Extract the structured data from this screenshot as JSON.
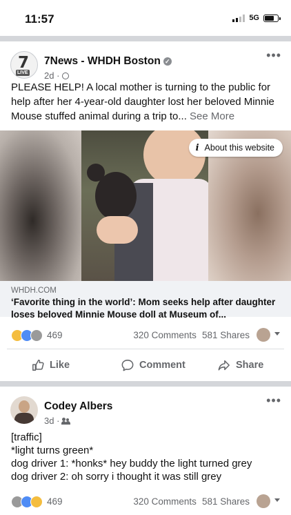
{
  "status_bar": {
    "time": "11:57",
    "network": "5G",
    "battery_level": 0.65
  },
  "post1": {
    "page_name": "7News - WHDH Boston",
    "avatar_text": "7",
    "avatar_badge": "LIVE",
    "meta": "2d ·",
    "body": "PLEASE HELP!  A local mother is turning to the public for help after her 4-year-old daughter lost her beloved Minnie Mouse stuffed animal during a trip to...",
    "see_more": "See More",
    "about_site": "About this website",
    "link_domain": "WHDH.COM",
    "link_title": "‘Favorite thing in the world’: Mom seeks help after daughter loses beloved Minnie Mouse doll at Museum of...",
    "reaction_count": "469",
    "comments": "320 Comments",
    "shares": "581 Shares",
    "actions": {
      "like": "Like",
      "comment": "Comment",
      "share": "Share"
    }
  },
  "post2": {
    "author": "Codey Albers",
    "meta": "3d ·",
    "lines": [
      "[traffic]",
      "*light turns green*",
      "dog driver 1: *honks* hey buddy the light turned grey",
      "dog driver 2: oh sorry i thought it was still grey"
    ],
    "reaction_count": "469",
    "comments": "320 Comments",
    "shares": "581 Shares"
  },
  "colors": {
    "secondary_text": "#65676b",
    "separator": "#d4d6da",
    "link_box_bg": "#f0f2f5"
  },
  "icons": [
    "signal-icon",
    "battery-icon",
    "verified-icon",
    "globe-icon",
    "more-icon",
    "info-icon",
    "like-icon",
    "comment-icon",
    "share-icon",
    "friends-icon"
  ]
}
